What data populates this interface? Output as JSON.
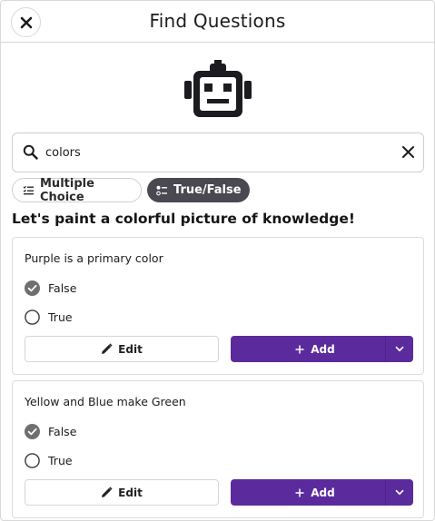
{
  "header": {
    "title": "Find Questions",
    "close_icon": "close-icon"
  },
  "robot_icon": "robot-icon",
  "search": {
    "value": "colors",
    "placeholder": "Search",
    "search_icon": "search-icon",
    "clear_icon": "clear-icon"
  },
  "filters": [
    {
      "label": "Multiple Choice",
      "icon": "checklist-icon",
      "selected": false
    },
    {
      "label": "True/False",
      "icon": "true-false-icon",
      "selected": true
    }
  ],
  "heading": "Let's paint a colorful picture of knowledge!",
  "questions": [
    {
      "text": "Purple is a primary color",
      "options": [
        {
          "label": "False",
          "correct": true
        },
        {
          "label": "True",
          "correct": false
        }
      ],
      "edit_label": "Edit",
      "add_label": "Add"
    },
    {
      "text": "Yellow and Blue make Green",
      "options": [
        {
          "label": "False",
          "correct": true
        },
        {
          "label": "True",
          "correct": false
        }
      ],
      "edit_label": "Edit",
      "add_label": "Add"
    }
  ],
  "colors": {
    "accent": "#5b2b9e",
    "chip_selected": "#4a4850",
    "text": "#1c1b1f"
  }
}
